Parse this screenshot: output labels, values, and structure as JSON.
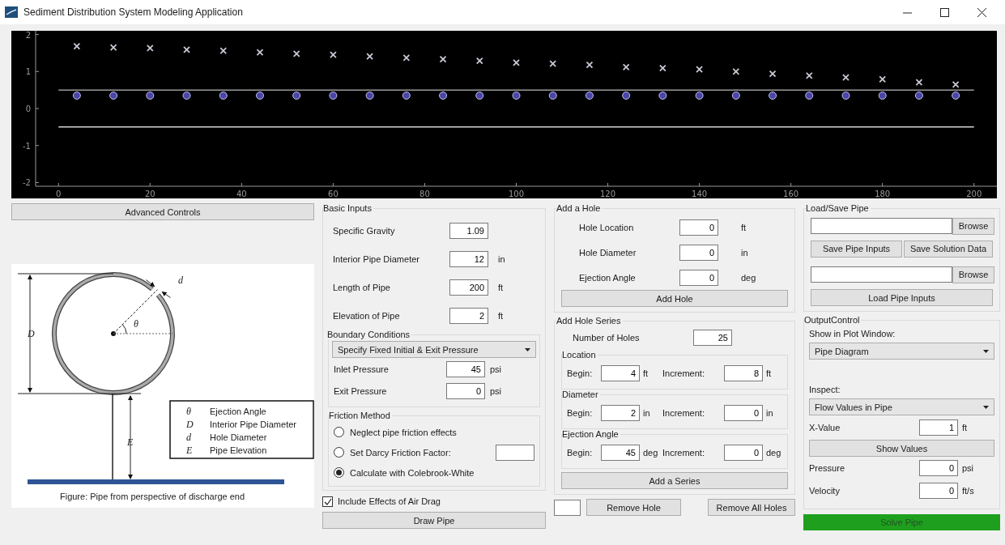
{
  "window": {
    "title": "Sediment Distribution System Modeling Application"
  },
  "plot": {
    "chart_data": {
      "type": "scatter",
      "xlim": [
        -5,
        205
      ],
      "ylim": [
        -2.1,
        2.1
      ],
      "xticks": [
        0,
        20,
        40,
        60,
        80,
        100,
        120,
        140,
        160,
        180,
        200
      ],
      "yticks": [
        -2,
        -1,
        0,
        1,
        2
      ],
      "x": [
        4,
        12,
        20,
        28,
        36,
        44,
        52,
        60,
        68,
        76,
        84,
        92,
        100,
        108,
        116,
        124,
        132,
        140,
        148,
        156,
        164,
        172,
        180,
        188,
        196
      ],
      "series": [
        {
          "color": "#c8c8d4",
          "values": [
            1.68,
            1.65,
            1.63,
            1.59,
            1.56,
            1.52,
            1.48,
            1.45,
            1.41,
            1.37,
            1.33,
            1.29,
            1.24,
            1.21,
            1.18,
            1.12,
            1.09,
            1.06,
            1.0,
            0.94,
            0.89,
            0.84,
            0.79,
            0.71,
            0.65
          ]
        },
        {
          "color": "#4b45a8",
          "values": [
            0.35,
            0.35,
            0.35,
            0.35,
            0.35,
            0.35,
            0.35,
            0.35,
            0.35,
            0.35,
            0.35,
            0.35,
            0.35,
            0.35,
            0.35,
            0.35,
            0.35,
            0.35,
            0.35,
            0.35,
            0.35,
            0.35,
            0.35,
            0.35,
            0.35
          ]
        }
      ],
      "ref_lines": [
        {
          "axis": "y",
          "value": 0.5
        },
        {
          "axis": "y",
          "value": -0.5
        }
      ]
    }
  },
  "advanced_button": "Advanced Controls",
  "figure": {
    "marks": {
      "diameter": "D",
      "hole": "d",
      "angle": "θ",
      "elevation": "E"
    },
    "legend": [
      {
        "symbol": "θ",
        "text": "Ejection Angle"
      },
      {
        "symbol": "D",
        "text": "Interior Pipe Diameter"
      },
      {
        "symbol": "d",
        "text": "Hole Diameter"
      },
      {
        "symbol": "E",
        "text": "Pipe Elevation"
      }
    ],
    "caption": "Figure: Pipe from perspective of discharge end"
  },
  "basic_inputs": {
    "title": "Basic Inputs",
    "fields": [
      {
        "label": "Specific Gravity",
        "value": "1.09"
      },
      {
        "label": "Interior Pipe Diameter",
        "value": "12",
        "unit": "in"
      },
      {
        "label": "Length of Pipe",
        "value": "200",
        "unit": "ft"
      },
      {
        "label": "Elevation of Pipe",
        "value": "2",
        "unit": "ft"
      }
    ],
    "boundary": {
      "title": "Boundary Conditions",
      "select": "Specify Fixed Initial & Exit Pressure",
      "fields": [
        {
          "label": "Inlet Pressure",
          "value": "45",
          "unit": "psi"
        },
        {
          "label": "Exit Pressure",
          "value": "0",
          "unit": "psi"
        }
      ]
    },
    "friction": {
      "title": "Friction Method",
      "options": [
        {
          "label": "Neglect pipe friction effects",
          "selected": false,
          "kind": "plain"
        },
        {
          "label": "Set Darcy Friction Factor:",
          "selected": false,
          "kind": "with_field"
        },
        {
          "label": "Calculate with Colebrook-White",
          "selected": true,
          "kind": "plain"
        }
      ]
    },
    "air_drag": {
      "label": "Include Effects of Air Drag",
      "checked": true
    },
    "draw_button": "Draw Pipe"
  },
  "add_hole": {
    "title": "Add a Hole",
    "fields": [
      {
        "label": "Hole Location",
        "value": "0",
        "unit": "ft"
      },
      {
        "label": "Hole Diameter",
        "value": "0",
        "unit": "in"
      },
      {
        "label": "Ejection Angle",
        "value": "0",
        "unit": "deg"
      }
    ],
    "button": "Add Hole"
  },
  "hole_series": {
    "title": "Add Hole Series",
    "count": {
      "label": "Number of Holes",
      "value": "25"
    },
    "groups": [
      {
        "title": "Location",
        "begin_label": "Begin:",
        "begin_value": "4",
        "begin_unit": "ft",
        "inc_label": "Increment:",
        "inc_value": "8",
        "inc_unit": "ft"
      },
      {
        "title": "Diameter",
        "begin_label": "Begin:",
        "begin_value": "2",
        "begin_unit": "in",
        "inc_label": "Increment:",
        "inc_value": "0",
        "inc_unit": "in"
      },
      {
        "title": "Ejection Angle",
        "begin_label": "Begin:",
        "begin_value": "45",
        "begin_unit": "deg",
        "inc_label": "Increment:",
        "inc_value": "0",
        "inc_unit": "deg"
      }
    ],
    "button": "Add a Series"
  },
  "hole_removal": {
    "buttons": [
      "Remove Hole",
      "Remove All Holes"
    ]
  },
  "load_save": {
    "title": "Load/Save Pipe",
    "browse_buttons": [
      "Browse",
      "Browse"
    ],
    "save_buttons": [
      "Save Pipe Inputs",
      "Save Solution Data"
    ],
    "load_button": "Load Pipe Inputs"
  },
  "output_control": {
    "title": "OutputControl",
    "plot_label": "Show in Plot Window:",
    "plot_select": "Pipe Diagram",
    "inspect_label": "Inspect:",
    "inspect_select": "Flow Values in Pipe",
    "x_value": {
      "label": "X-Value",
      "value": "1",
      "unit": "ft"
    },
    "show_button": "Show Values",
    "readouts": [
      {
        "label": "Pressure",
        "value": "0",
        "unit": "psi"
      },
      {
        "label": "Velocity",
        "value": "0",
        "unit": "ft/s"
      }
    ]
  },
  "solve_button": "Solve Pipe"
}
